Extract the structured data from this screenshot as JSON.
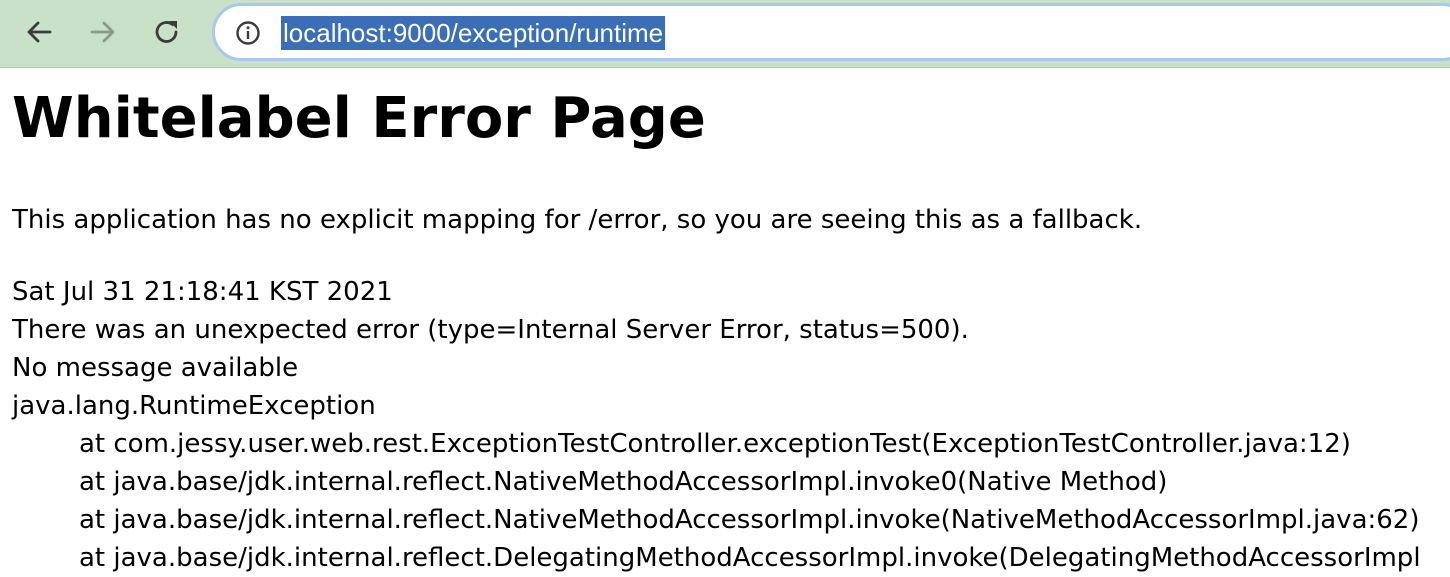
{
  "browser": {
    "url": "localhost:9000/exception/runtime",
    "back_icon": "arrow-left-icon",
    "forward_icon": "arrow-right-icon",
    "reload_icon": "reload-icon",
    "site_info_icon": "info-circle-icon"
  },
  "page": {
    "title": "Whitelabel Error Page",
    "fallback_message": "This application has no explicit mapping for /error, so you are seeing this as a fallback.",
    "timestamp": "Sat Jul 31 21:18:41 KST 2021",
    "error_summary": "There was an unexpected error (type=Internal Server Error, status=500).",
    "message": "No message available",
    "exception": "java.lang.RuntimeException",
    "stack_trace": [
      "at com.jessy.user.web.rest.ExceptionTestController.exceptionTest(ExceptionTestController.java:12)",
      "at java.base/jdk.internal.reflect.NativeMethodAccessorImpl.invoke0(Native Method)",
      "at java.base/jdk.internal.reflect.NativeMethodAccessorImpl.invoke(NativeMethodAccessorImpl.java:62)",
      "at java.base/jdk.internal.reflect.DelegatingMethodAccessorImpl.invoke(DelegatingMethodAccessorImpl"
    ]
  },
  "colors": {
    "toolbar_bg": "#c8e1c8",
    "omnibox_border": "#a8c8ee",
    "selection_bg": "#3a6fb8"
  }
}
